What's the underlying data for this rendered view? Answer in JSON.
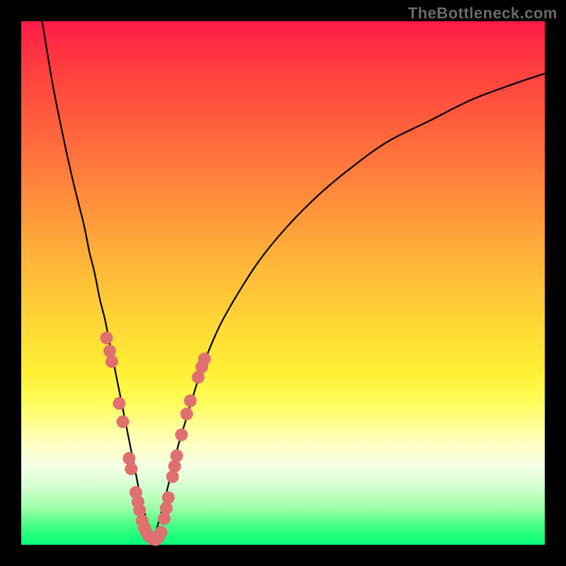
{
  "watermark": "TheBottleneck.com",
  "chart_data": {
    "type": "line",
    "title": "",
    "xlabel": "",
    "ylabel": "",
    "xlim": [
      0,
      100
    ],
    "ylim": [
      0,
      100
    ],
    "grid": false,
    "series": [
      {
        "name": "curve-left",
        "x": [
          4,
          6,
          8,
          10,
          12,
          13,
          14,
          15,
          16,
          17,
          18,
          19,
          20,
          21,
          22,
          22.8,
          23.6,
          24.2,
          25
        ],
        "y": [
          100,
          88,
          78,
          69,
          61,
          56,
          52,
          47,
          43,
          38,
          33,
          28,
          23,
          18,
          13,
          9,
          6,
          3.5,
          1
        ]
      },
      {
        "name": "curve-right",
        "x": [
          25,
          26,
          27,
          28,
          29,
          30,
          31.5,
          33,
          35,
          38,
          42,
          46,
          51,
          57,
          63,
          70,
          78,
          86,
          94,
          100
        ],
        "y": [
          1,
          3.5,
          7,
          11,
          15,
          19,
          24,
          29,
          35,
          42,
          49,
          55,
          61,
          67,
          72,
          77,
          81,
          85,
          88,
          90
        ]
      }
    ],
    "markers": [
      {
        "name": "dot-cluster-left",
        "color": "#e07070",
        "points": [
          {
            "x": 16.3,
            "y": 39.5
          },
          {
            "x": 16.9,
            "y": 37.0
          },
          {
            "x": 17.3,
            "y": 35.0
          },
          {
            "x": 18.7,
            "y": 27.0
          },
          {
            "x": 19.4,
            "y": 23.5
          },
          {
            "x": 20.6,
            "y": 16.5
          },
          {
            "x": 21.0,
            "y": 14.5
          },
          {
            "x": 21.9,
            "y": 10.0
          },
          {
            "x": 22.3,
            "y": 8.2
          },
          {
            "x": 22.6,
            "y": 6.6
          },
          {
            "x": 23.1,
            "y": 4.6
          },
          {
            "x": 23.5,
            "y": 3.3
          },
          {
            "x": 23.9,
            "y": 2.4
          },
          {
            "x": 24.3,
            "y": 1.8
          },
          {
            "x": 24.7,
            "y": 1.4
          },
          {
            "x": 25.2,
            "y": 1.1
          },
          {
            "x": 25.7,
            "y": 1.0
          },
          {
            "x": 26.2,
            "y": 1.4
          },
          {
            "x": 26.7,
            "y": 2.4
          }
        ]
      },
      {
        "name": "dot-cluster-right",
        "color": "#e07070",
        "points": [
          {
            "x": 27.3,
            "y": 5.0
          },
          {
            "x": 27.7,
            "y": 7.0
          },
          {
            "x": 28.1,
            "y": 9.0
          },
          {
            "x": 28.9,
            "y": 13.0
          },
          {
            "x": 29.3,
            "y": 15.0
          },
          {
            "x": 29.7,
            "y": 17.0
          },
          {
            "x": 30.6,
            "y": 21.0
          },
          {
            "x": 31.6,
            "y": 25.0
          },
          {
            "x": 32.3,
            "y": 27.5
          },
          {
            "x": 33.8,
            "y": 32.0
          },
          {
            "x": 34.5,
            "y": 34.0
          },
          {
            "x": 35.0,
            "y": 35.5
          }
        ]
      }
    ]
  }
}
